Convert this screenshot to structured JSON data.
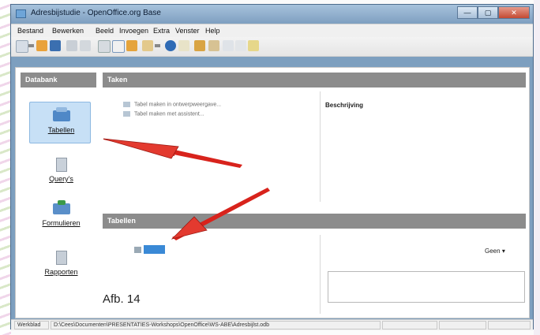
{
  "window": {
    "title": "Adresbijstudie - OpenOffice.org Base",
    "buttons": {
      "minimize": "—",
      "maximize": "▢",
      "close": "✕"
    }
  },
  "menubar": {
    "items": [
      "Bestand",
      "Bewerken",
      "Beeld",
      "Invoegen",
      "Extra",
      "Venster",
      "Help"
    ]
  },
  "left_pane": {
    "header": "Databank",
    "items": [
      {
        "label": "Tabellen"
      },
      {
        "label": "Query's"
      },
      {
        "label": "Formulieren"
      },
      {
        "label": "Rapporten"
      }
    ]
  },
  "tasks_pane": {
    "header": "Taken",
    "tasks": [
      "Tabel maken in ontwerpweergave...",
      "Tabel maken met assistent..."
    ],
    "description_label": "Beschrijving"
  },
  "tables_pane": {
    "header": "Tabellen",
    "selected_node_label": "",
    "preview_dropdown": "Geen"
  },
  "caption": "Afb. 14",
  "statusbar": {
    "mode": "Werkblad",
    "path": "D:\\Cees\\Documenten\\PRESENTATIES-Workshops\\OpenOffice\\WS-ABE\\Adresbijlst.odb"
  },
  "colors": {
    "title_bar": "#7e9fc0",
    "pane_header": "#8c8c8c",
    "selection": "#c7e0f6",
    "arrow": "#d8231c"
  }
}
